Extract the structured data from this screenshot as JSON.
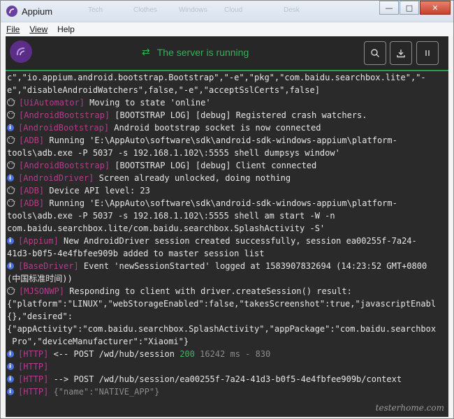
{
  "window": {
    "title": "Appium",
    "ghost_tabs": [
      "Tech",
      "Clothes",
      "Windows",
      "Cloud",
      "Desk"
    ]
  },
  "menu": {
    "file": "File",
    "view": "View",
    "help": "Help"
  },
  "header": {
    "status_text": "The server is running",
    "status_color": "#2fb45a"
  },
  "log": {
    "lines": [
      {
        "parts": [
          {
            "t": "c\",\"io.appium.android.bootstrap.Bootstrap\",\"-e\",\"pkg\",\"com.baidu.searchbox.lite\",\"-"
          }
        ]
      },
      {
        "parts": [
          {
            "t": "e\",\"disableAndroidWatchers\",false,\"-e\",\"acceptSslCerts\",false]"
          }
        ]
      },
      {
        "icon": "debug",
        "parts": [
          {
            "t": "[UiAutomator]",
            "c": "tag"
          },
          {
            "t": " Moving to state 'online'"
          }
        ]
      },
      {
        "icon": "debug",
        "parts": [
          {
            "t": "[AndroidBootstrap]",
            "c": "tag"
          },
          {
            "t": " [BOOTSTRAP LOG] [debug] Registered crash watchers."
          }
        ]
      },
      {
        "icon": "info",
        "parts": [
          {
            "t": "[AndroidBootstrap]",
            "c": "tag"
          },
          {
            "t": " Android bootstrap socket is now connected"
          }
        ]
      },
      {
        "icon": "debug",
        "parts": [
          {
            "t": "[ADB]",
            "c": "tag"
          },
          {
            "t": " Running 'E:\\AppAuto\\software\\sdk\\android-sdk-windows-appium\\platform-"
          }
        ]
      },
      {
        "parts": [
          {
            "t": "tools\\adb.exe -P 5037 -s 192.168.1.102\\:5555 shell dumpsys window'"
          }
        ]
      },
      {
        "icon": "debug",
        "parts": [
          {
            "t": "[AndroidBootstrap]",
            "c": "tag"
          },
          {
            "t": " [BOOTSTRAP LOG] [debug] Client connected"
          }
        ]
      },
      {
        "icon": "info",
        "parts": [
          {
            "t": "[AndroidDriver]",
            "c": "tag"
          },
          {
            "t": " Screen already unlocked, doing nothing"
          }
        ]
      },
      {
        "icon": "debug",
        "parts": [
          {
            "t": "[ADB]",
            "c": "tag"
          },
          {
            "t": " Device API level: 23"
          }
        ]
      },
      {
        "icon": "debug",
        "parts": [
          {
            "t": "[ADB]",
            "c": "tag"
          },
          {
            "t": " Running 'E:\\AppAuto\\software\\sdk\\android-sdk-windows-appium\\platform-"
          }
        ]
      },
      {
        "parts": [
          {
            "t": "tools\\adb.exe -P 5037 -s 192.168.1.102\\:5555 shell am start -W -n"
          }
        ]
      },
      {
        "parts": [
          {
            "t": "com.baidu.searchbox.lite/com.baidu.searchbox.SplashActivity -S'"
          }
        ]
      },
      {
        "icon": "info",
        "parts": [
          {
            "t": "[Appium]",
            "c": "tag"
          },
          {
            "t": " New AndroidDriver session created successfully, session ea00255f-7a24-"
          }
        ]
      },
      {
        "parts": [
          {
            "t": "41d3-b0f5-4e4fbfee909b added to master session list"
          }
        ]
      },
      {
        "icon": "info",
        "parts": [
          {
            "t": "[BaseDriver]",
            "c": "tag"
          },
          {
            "t": " Event 'newSessionStarted' logged at 1583907832694 (14:23:52 GMT+0800"
          }
        ]
      },
      {
        "parts": [
          {
            "t": "(中国标准时间))"
          }
        ]
      },
      {
        "icon": "debug",
        "parts": [
          {
            "t": "[MJSONWP]",
            "c": "tag"
          },
          {
            "t": " Responding to client with driver.createSession() result:"
          }
        ]
      },
      {
        "parts": [
          {
            "t": "{\"platform\":\"LINUX\",\"webStorageEnabled\":false,\"takesScreenshot\":true,\"javascriptEnabl"
          }
        ]
      },
      {
        "parts": [
          {
            "t": "{},\"desired\":"
          }
        ]
      },
      {
        "parts": [
          {
            "t": "{\"appActivity\":\"com.baidu.searchbox.SplashActivity\",\"appPackage\":\"com.baidu.searchbox"
          }
        ]
      },
      {
        "parts": [
          {
            "t": " Pro\",\"deviceManufacturer\":\"Xiaomi\"}"
          }
        ]
      },
      {
        "icon": "info",
        "parts": [
          {
            "t": "[HTTP]",
            "c": "tag"
          },
          {
            "t": " <-- POST /wd/hub/session "
          },
          {
            "t": "200",
            "c": "green"
          },
          {
            "t": " 16242 ms - 830",
            "c": "grey"
          }
        ]
      },
      {
        "icon": "info",
        "parts": [
          {
            "t": "[HTTP]",
            "c": "tag"
          }
        ]
      },
      {
        "icon": "info",
        "parts": [
          {
            "t": "[HTTP]",
            "c": "tag"
          },
          {
            "t": " --> POST /wd/hub/session/ea00255f-7a24-41d3-b0f5-4e4fbfee909b/context"
          }
        ]
      },
      {
        "icon": "info",
        "parts": [
          {
            "t": "[HTTP]",
            "c": "tag"
          },
          {
            "t": " {\"name\":\"NATIVE_APP\"}",
            "c": "grey"
          }
        ]
      }
    ]
  },
  "watermark": "testerhome.com",
  "icons": {
    "search": "search-icon",
    "download": "download-icon",
    "pause": "pause-icon"
  }
}
